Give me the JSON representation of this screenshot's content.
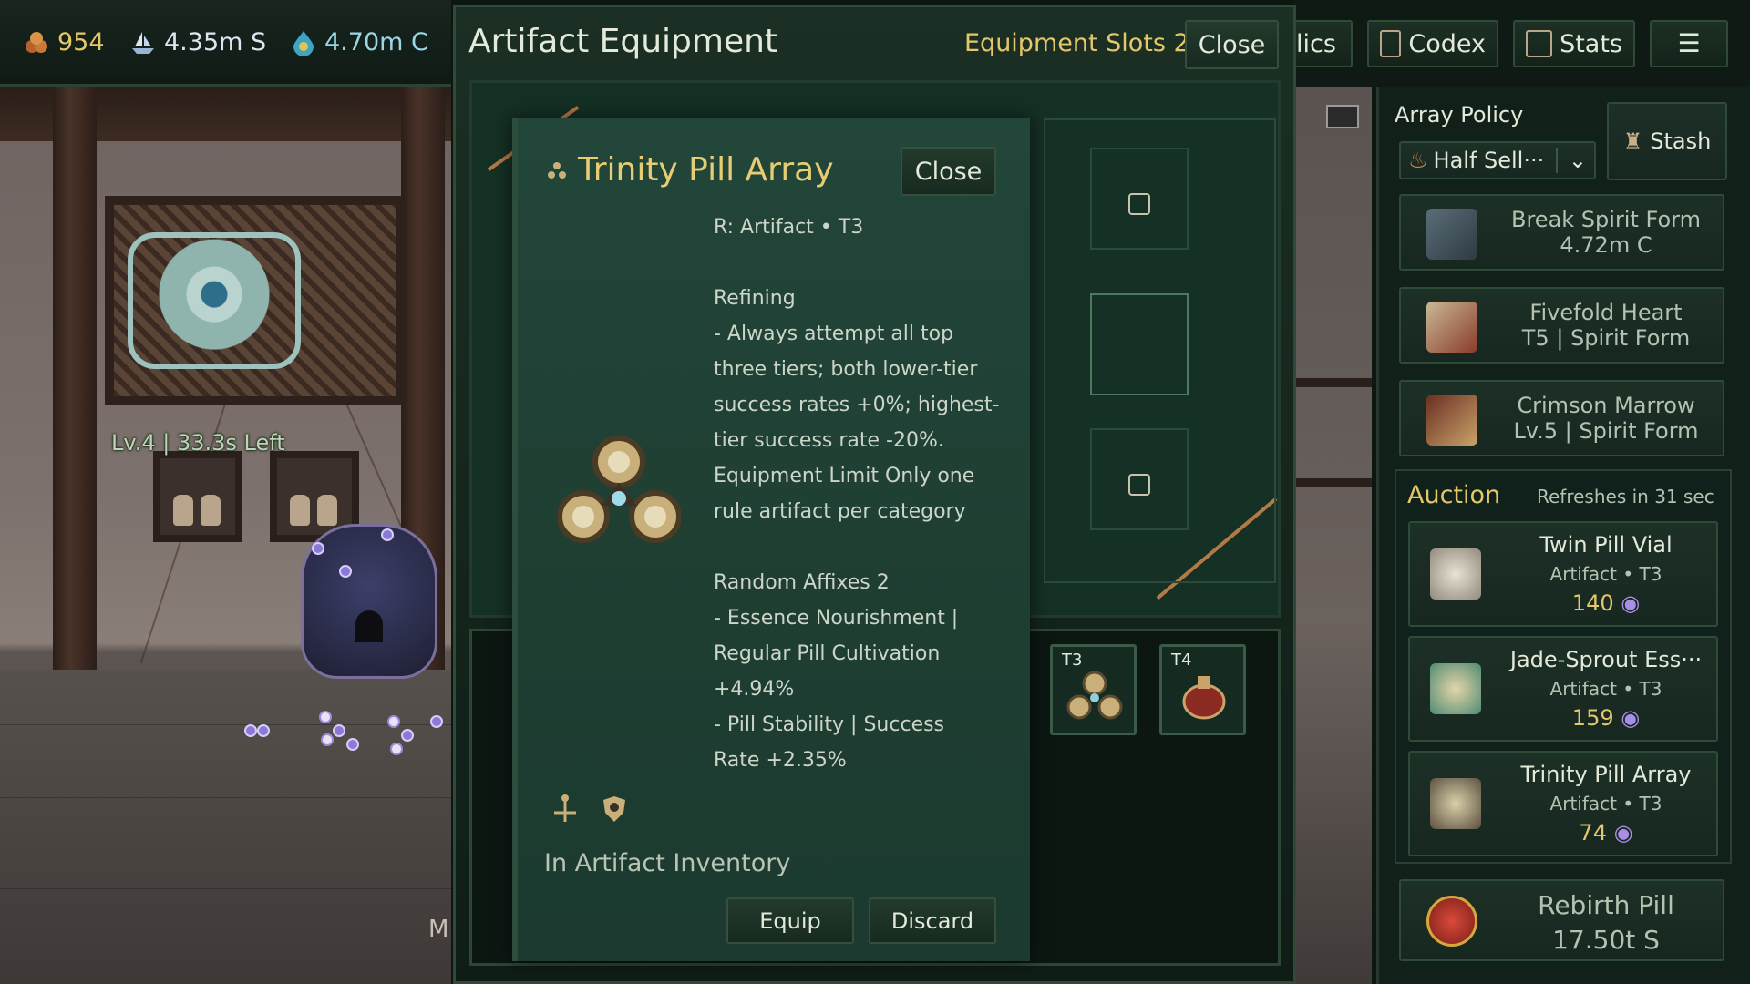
{
  "resources": [
    {
      "icon": "spirit-stone-icon",
      "value": "954"
    },
    {
      "icon": "ship-icon",
      "value": "4.35m S"
    },
    {
      "icon": "water-drop-icon",
      "value": "4.70m C"
    }
  ],
  "top_nav": {
    "relics_label": "lics",
    "codex_label": "Codex",
    "stats_label": "Stats"
  },
  "scene": {
    "label": "Lv.4 | 33.3s Left",
    "edge_text": "M"
  },
  "equipment_window": {
    "title": "Artifact Equipment",
    "slots_label": "Equipment Slots 2",
    "close_label": "Close",
    "inventory_slots": [
      {
        "tier": "T3",
        "icon": "trinity-pill-array-icon"
      },
      {
        "tier": "T4",
        "icon": "red-cauldron-icon"
      }
    ]
  },
  "tooltip": {
    "title": "Trinity Pill Array",
    "close_label": "Close",
    "lines": [
      "R: Artifact • T3",
      "",
      "Refining",
      "- Always attempt all top",
      "three tiers; both lower-tier",
      "success rates +0%; highest-",
      "tier success rate -20%.",
      "Equipment Limit  Only one",
      "rule artifact per category",
      "",
      "Random Affixes  2",
      "- Essence Nourishment |",
      "Regular Pill Cultivation",
      "+4.94%",
      "- Pill Stability | Success",
      "Rate  +2.35%"
    ],
    "location": "In Artifact Inventory",
    "equip_label": "Equip",
    "discard_label": "Discard"
  },
  "side_panel": {
    "array_policy_label": "Array Policy",
    "policy_value": "Half Sell···",
    "stash_label": "Stash",
    "forms": [
      {
        "name": "Break Spirit Form",
        "detail": "4.72m C",
        "icon": "break-spirit-icon"
      },
      {
        "name": "Fivefold Heart",
        "detail": "T5 | Spirit Form",
        "icon": "fivefold-heart-icon"
      },
      {
        "name": "Crimson Marrow",
        "detail": "Lv.5 | Spirit Form",
        "icon": "crimson-marrow-icon"
      }
    ],
    "auction_title": "Auction",
    "auction_refresh": "Refreshes in 31 sec",
    "auction_items": [
      {
        "name": "Twin Pill Vial",
        "type": "Artifact • T3",
        "price": "140",
        "icon": "twin-pill-vial-icon"
      },
      {
        "name": "Jade-Sprout Ess···",
        "type": "Artifact • T3",
        "price": "159",
        "icon": "jade-sprout-icon"
      },
      {
        "name": "Trinity Pill Array",
        "type": "Artifact • T3",
        "price": "74",
        "icon": "trinity-pill-array-icon"
      }
    ],
    "rebirth": {
      "name": "Rebirth Pill",
      "value": "17.50t S",
      "icon": "rebirth-pill-icon"
    }
  },
  "colors": {
    "accent_gold": "#e6cc72",
    "panel_green": "#1f3f33",
    "price_gold": "#e3c76a"
  }
}
